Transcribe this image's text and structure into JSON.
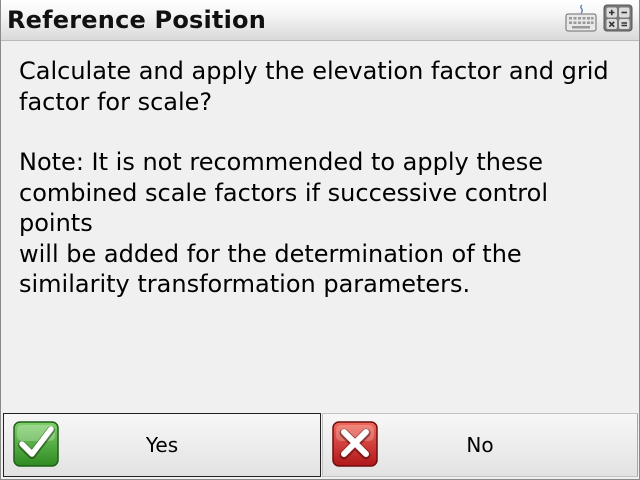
{
  "dialog": {
    "title": "Reference Position",
    "icons": {
      "keyboard": "keyboard-icon",
      "calculator": "calculator-icon"
    },
    "message": {
      "question_line1": "Calculate and apply the elevation factor and grid",
      "question_line2": "factor for scale?",
      "note_line1": "Note: It is not recommended to apply these",
      "note_line2": "combined scale factors if successive control points",
      "note_line3": "will be added for the determination of the",
      "note_line4": "similarity transformation parameters."
    }
  },
  "buttons": {
    "yes": {
      "label": "Yes",
      "icon": "check-icon",
      "icon_color": "#3a9a2a"
    },
    "no": {
      "label": "No",
      "icon": "x-icon",
      "icon_color": "#c8211e"
    }
  }
}
